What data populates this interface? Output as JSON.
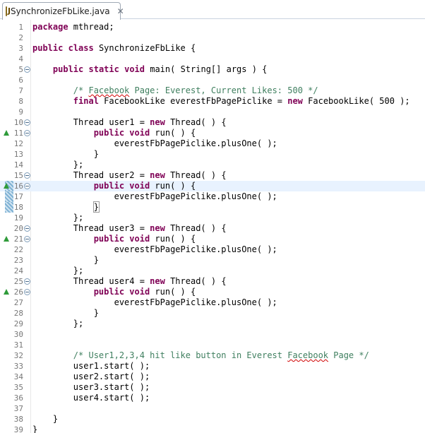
{
  "tab": {
    "title": "SynchronizeFbLike.java",
    "close_glyph": "✕",
    "file_icon": "java-file-icon",
    "file_icon_letter": "J"
  },
  "colors": {
    "keyword": "#7f0055",
    "comment": "#3f7f5f",
    "line_number": "#787878",
    "current_line": "#e8f2fe",
    "override_marker": "#2f9b3a"
  },
  "editor": {
    "current_line": 16,
    "lines": [
      {
        "n": "1",
        "tokens": [
          {
            "t": "package",
            "c": "kw"
          },
          {
            "t": " mthread;"
          }
        ]
      },
      {
        "n": "2",
        "tokens": []
      },
      {
        "n": "3",
        "tokens": [
          {
            "t": "public",
            "c": "kw"
          },
          {
            "t": " "
          },
          {
            "t": "class",
            "c": "kw"
          },
          {
            "t": " SynchronizeFbLike {"
          }
        ]
      },
      {
        "n": "4",
        "tokens": []
      },
      {
        "n": "5",
        "fold": true,
        "tokens": [
          {
            "t": "    "
          },
          {
            "t": "public",
            "c": "kw"
          },
          {
            "t": " "
          },
          {
            "t": "static",
            "c": "kw"
          },
          {
            "t": " "
          },
          {
            "t": "void",
            "c": "kw"
          },
          {
            "t": " main( String[] args ) {"
          }
        ]
      },
      {
        "n": "6",
        "tokens": []
      },
      {
        "n": "7",
        "tokens": [
          {
            "t": "        "
          },
          {
            "t": "/* ",
            "c": "cm"
          },
          {
            "t": "Facebook",
            "c": "cm",
            "sq": true
          },
          {
            "t": " Page: Everest, Current Likes: 500 */",
            "c": "cm"
          }
        ]
      },
      {
        "n": "8",
        "tokens": [
          {
            "t": "        "
          },
          {
            "t": "final",
            "c": "kw"
          },
          {
            "t": " FacebookLike everestFbPagePiclike = "
          },
          {
            "t": "new",
            "c": "kw"
          },
          {
            "t": " FacebookLike( 500 );"
          }
        ]
      },
      {
        "n": "9",
        "tokens": []
      },
      {
        "n": "10",
        "fold": true,
        "tokens": [
          {
            "t": "        Thread user1 = "
          },
          {
            "t": "new",
            "c": "kw"
          },
          {
            "t": " Thread( ) {"
          }
        ]
      },
      {
        "n": "11",
        "fold": true,
        "override": true,
        "tokens": [
          {
            "t": "            "
          },
          {
            "t": "public",
            "c": "kw"
          },
          {
            "t": " "
          },
          {
            "t": "void",
            "c": "kw"
          },
          {
            "t": " run( ) {"
          }
        ]
      },
      {
        "n": "12",
        "tokens": [
          {
            "t": "                everestFbPagePiclike.plusOne( );"
          }
        ]
      },
      {
        "n": "13",
        "tokens": [
          {
            "t": "            }"
          }
        ]
      },
      {
        "n": "14",
        "tokens": [
          {
            "t": "        };"
          }
        ]
      },
      {
        "n": "15",
        "fold": true,
        "tokens": [
          {
            "t": "        Thread user2 = "
          },
          {
            "t": "new",
            "c": "kw"
          },
          {
            "t": " Thread( ) {"
          }
        ]
      },
      {
        "n": "16",
        "fold": true,
        "override": true,
        "change": true,
        "tokens": [
          {
            "t": "            "
          },
          {
            "t": "public",
            "c": "kw"
          },
          {
            "t": " "
          },
          {
            "t": "void",
            "c": "kw"
          },
          {
            "t": " run( ) {"
          }
        ]
      },
      {
        "n": "17",
        "change": true,
        "tokens": [
          {
            "t": "                everestFbPagePiclike.plusOne( );"
          }
        ]
      },
      {
        "n": "18",
        "change": true,
        "tokens": [
          {
            "t": "            "
          },
          {
            "t": "}",
            "c": "caret-brace"
          }
        ]
      },
      {
        "n": "19",
        "tokens": [
          {
            "t": "        };"
          }
        ]
      },
      {
        "n": "20",
        "fold": true,
        "tokens": [
          {
            "t": "        Thread user3 = "
          },
          {
            "t": "new",
            "c": "kw"
          },
          {
            "t": " Thread( ) {"
          }
        ]
      },
      {
        "n": "21",
        "fold": true,
        "override": true,
        "tokens": [
          {
            "t": "            "
          },
          {
            "t": "public",
            "c": "kw"
          },
          {
            "t": " "
          },
          {
            "t": "void",
            "c": "kw"
          },
          {
            "t": " run( ) {"
          }
        ]
      },
      {
        "n": "22",
        "tokens": [
          {
            "t": "                everestFbPagePiclike.plusOne( );"
          }
        ]
      },
      {
        "n": "23",
        "tokens": [
          {
            "t": "            }"
          }
        ]
      },
      {
        "n": "24",
        "tokens": [
          {
            "t": "        };"
          }
        ]
      },
      {
        "n": "25",
        "fold": true,
        "tokens": [
          {
            "t": "        Thread user4 = "
          },
          {
            "t": "new",
            "c": "kw"
          },
          {
            "t": " Thread( ) {"
          }
        ]
      },
      {
        "n": "26",
        "fold": true,
        "override": true,
        "tokens": [
          {
            "t": "            "
          },
          {
            "t": "public",
            "c": "kw"
          },
          {
            "t": " "
          },
          {
            "t": "void",
            "c": "kw"
          },
          {
            "t": " run( ) {"
          }
        ]
      },
      {
        "n": "27",
        "tokens": [
          {
            "t": "                everestFbPagePiclike.plusOne( );"
          }
        ]
      },
      {
        "n": "28",
        "tokens": [
          {
            "t": "            }"
          }
        ]
      },
      {
        "n": "29",
        "tokens": [
          {
            "t": "        };"
          }
        ]
      },
      {
        "n": "30",
        "tokens": []
      },
      {
        "n": "31",
        "tokens": []
      },
      {
        "n": "32",
        "tokens": [
          {
            "t": "        "
          },
          {
            "t": "/* User1,2,3,4 hit like button in Everest ",
            "c": "cm"
          },
          {
            "t": "Facebook",
            "c": "cm",
            "sq": true
          },
          {
            "t": " Page */",
            "c": "cm"
          }
        ]
      },
      {
        "n": "33",
        "tokens": [
          {
            "t": "        user1.start( );"
          }
        ]
      },
      {
        "n": "34",
        "tokens": [
          {
            "t": "        user2.start( );"
          }
        ]
      },
      {
        "n": "35",
        "tokens": [
          {
            "t": "        user3.start( );"
          }
        ]
      },
      {
        "n": "36",
        "tokens": [
          {
            "t": "        user4.start( );"
          }
        ]
      },
      {
        "n": "37",
        "tokens": []
      },
      {
        "n": "38",
        "tokens": [
          {
            "t": "    }"
          }
        ]
      },
      {
        "n": "39",
        "tokens": [
          {
            "t": "}"
          }
        ]
      }
    ]
  }
}
